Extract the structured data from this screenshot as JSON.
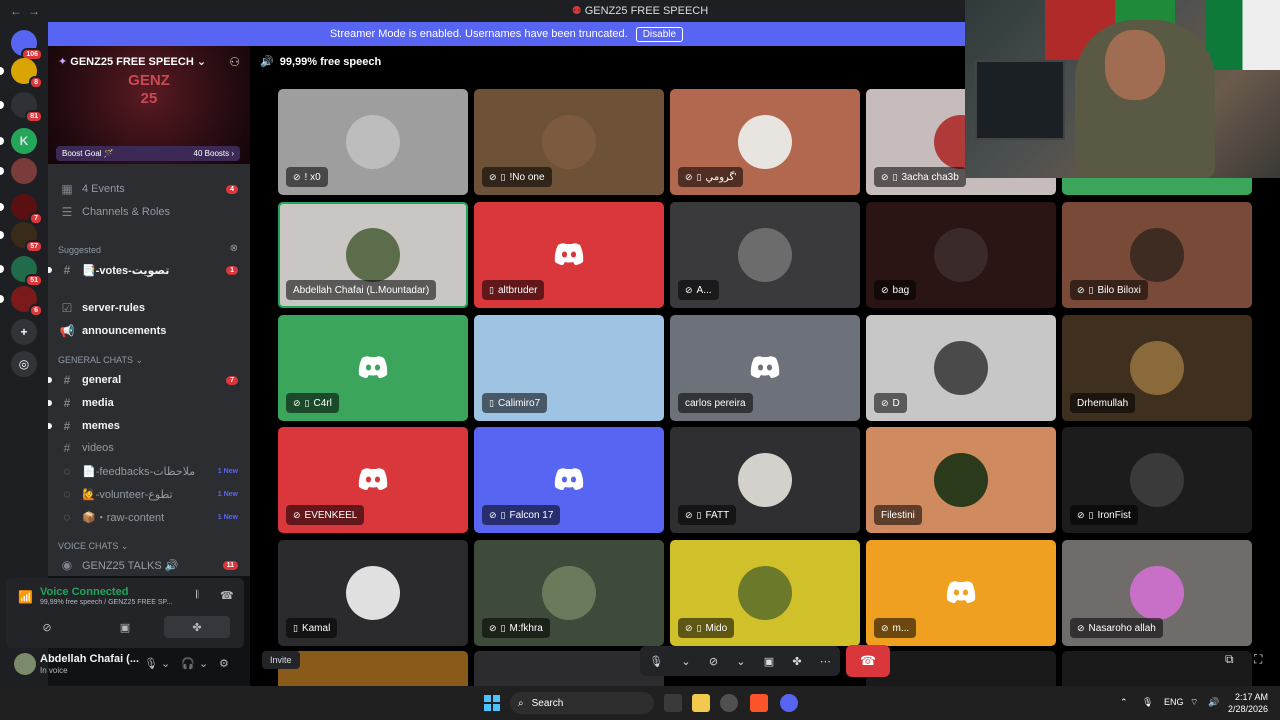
{
  "window": {
    "title": "GENZ25 FREE SPEECH",
    "back": "←",
    "forward": "→"
  },
  "banner": {
    "text": "Streamer Mode is enabled. Usernames have been truncated.",
    "button": "Disable"
  },
  "rail": {
    "servers": [
      {
        "icon": "discord-home-icon",
        "badge": "106",
        "color": "#5865f2"
      },
      {
        "icon": "server-icon",
        "badge": "8",
        "color": "#d9a400"
      },
      {
        "icon": "server-icon",
        "badge": "81",
        "color": "#2f3136"
      },
      {
        "icon": "server-icon",
        "badge": "",
        "color": "#23a55a",
        "text": "K"
      },
      {
        "icon": "server-icon",
        "badge": "",
        "color": "#7a3b3b"
      },
      {
        "icon": "server-icon",
        "badge": "7",
        "color": "#5a1010"
      },
      {
        "icon": "server-icon",
        "badge": "57",
        "color": "#3a2a1a"
      },
      {
        "icon": "server-icon",
        "badge": "51",
        "color": "#1f6b4a"
      },
      {
        "icon": "server-icon",
        "badge": "6",
        "color": "#7a1a1a"
      }
    ],
    "add_icon": "plus-icon",
    "discover_icon": "compass-icon"
  },
  "sidebar": {
    "server_name": "GENZ25 FREE SPEECH",
    "banner_text": "GENZ 25",
    "boost": {
      "label": "Boost Goal 🪄",
      "count": "40 Boosts ›"
    },
    "top_items": [
      {
        "label": "4 Events",
        "count": "4",
        "icon": "calendar-icon"
      },
      {
        "label": "Channels & Roles",
        "icon": "channels-icon"
      }
    ],
    "suggested_label": "Suggested",
    "suggested": [
      {
        "label": "📑-votes-تصويت",
        "count": "1"
      }
    ],
    "info_channels": [
      {
        "label": "server-rules",
        "icon": "rules-icon"
      },
      {
        "label": "announcements",
        "icon": "megaphone-icon"
      }
    ],
    "general_label": "GENERAL CHATS ⌄",
    "general": [
      {
        "label": "general",
        "count": "7",
        "bold": true
      },
      {
        "label": "media",
        "bold": true
      },
      {
        "label": "memes",
        "bold": true
      },
      {
        "label": "videos",
        "bold": false
      },
      {
        "label": "📄-feedbacks-ملاحظات",
        "new": "1 New",
        "thread": true
      },
      {
        "label": "🙋-volunteer-تطوع",
        "new": "1 New",
        "thread": true
      },
      {
        "label": "📦・raw-content",
        "new": "1 New",
        "thread": true
      }
    ],
    "voice_label": "VOICE CHATS ⌄",
    "voice": [
      {
        "label": "GENZ25 TALKS 🔊",
        "count": "11"
      }
    ]
  },
  "voice_panel": {
    "status": "Voice Connected",
    "channel": "99,99% free speech / GENZ25 FREE SP..."
  },
  "user_panel": {
    "name": "Abdellah Chafai (...",
    "status": "In voice"
  },
  "vc": {
    "name": "99,99% free speech"
  },
  "tiles": [
    {
      "name": "! x0",
      "bg": "#9e9e9e",
      "kind": "avatar",
      "avatar": "#bdbdbd",
      "muted": true
    },
    {
      "name": "!No one",
      "bg": "#6e5238",
      "kind": "avatar",
      "avatar": "#7b5a40",
      "muted": true,
      "phone": true
    },
    {
      "name": "گرومي'",
      "bg": "#b2674f",
      "kind": "avatar",
      "avatar": "#e8e4df",
      "muted": true,
      "phone": true
    },
    {
      "name": "3acha cha3b",
      "bg": "#c7bcbc",
      "kind": "avatar",
      "avatar": "#b03a3a",
      "muted": true,
      "phone": true
    },
    {
      "name": "",
      "bg": "#3ba55c",
      "kind": "blank",
      "muted": true
    },
    {
      "name": "Abdellah Chafai (L.Mountadar)",
      "bg": "#c9c6c4",
      "kind": "avatar",
      "avatar": "#5b6d4b",
      "speaking": true
    },
    {
      "name": "altbruder",
      "bg": "#da373c",
      "kind": "discord",
      "phone": true
    },
    {
      "name": "A...",
      "bg": "#3a3a3c",
      "kind": "avatar",
      "avatar": "#6c6c6c",
      "muted": true
    },
    {
      "name": "bag",
      "bg": "#2a1414",
      "kind": "avatar",
      "avatar": "#3b2a2a",
      "muted": true
    },
    {
      "name": "Bilo Biloxi",
      "bg": "#7a4a38",
      "kind": "avatar",
      "avatar": "#3e2b22",
      "muted": true,
      "phone": true
    },
    {
      "name": "C4rl",
      "bg": "#3ba55c",
      "kind": "discord",
      "muted": true,
      "phone": true
    },
    {
      "name": "Calimiro7",
      "bg": "#9fc3e3",
      "kind": "avatar",
      "avatar": "#9fc3e3",
      "phone": true
    },
    {
      "name": "carlos pereira",
      "bg": "#6d717a",
      "kind": "discord"
    },
    {
      "name": "D",
      "bg": "#c7c7c7",
      "kind": "avatar",
      "avatar": "#4a4a4a",
      "muted": true
    },
    {
      "name": "Drhemullah",
      "bg": "#3e2f1e",
      "kind": "avatar",
      "avatar": "#8a6a3a"
    },
    {
      "name": "EVENKEEL",
      "bg": "#da373c",
      "kind": "discord",
      "muted": true
    },
    {
      "name": "Falcon 17",
      "bg": "#5865f2",
      "kind": "discord",
      "muted": true,
      "phone": true
    },
    {
      "name": "FATT",
      "bg": "#2f2f31",
      "kind": "avatar",
      "avatar": "#d4d0cb",
      "muted": true,
      "phone": true
    },
    {
      "name": "Filestini",
      "bg": "#d08a5f",
      "kind": "avatar",
      "avatar": "#2a3a1a"
    },
    {
      "name": "IronFist",
      "bg": "#1c1c1c",
      "kind": "avatar",
      "avatar": "#3a3a3a",
      "muted": true,
      "phone": true
    },
    {
      "name": "Kamal",
      "bg": "#2b2b2d",
      "kind": "avatar",
      "avatar": "#e0e0e0",
      "phone": true
    },
    {
      "name": "M:fkhra",
      "bg": "#3e4a3a",
      "kind": "avatar",
      "avatar": "#6a7a5a",
      "muted": true,
      "phone": true
    },
    {
      "name": "Mido",
      "bg": "#d0c12b",
      "kind": "avatar",
      "avatar": "#6a7a2a",
      "muted": true,
      "phone": true
    },
    {
      "name": "m...",
      "bg": "#f0a020",
      "kind": "discord",
      "muted": true
    },
    {
      "name": "Nasaroho allah",
      "bg": "#6f6c6a",
      "kind": "avatar",
      "avatar": "#c870c8",
      "muted": true
    }
  ],
  "bottom": {
    "invite": "Invite"
  },
  "taskbar": {
    "search": "Search",
    "tray_lang": "ENG",
    "time": "2:17 AM",
    "date": "2/28/2026"
  }
}
